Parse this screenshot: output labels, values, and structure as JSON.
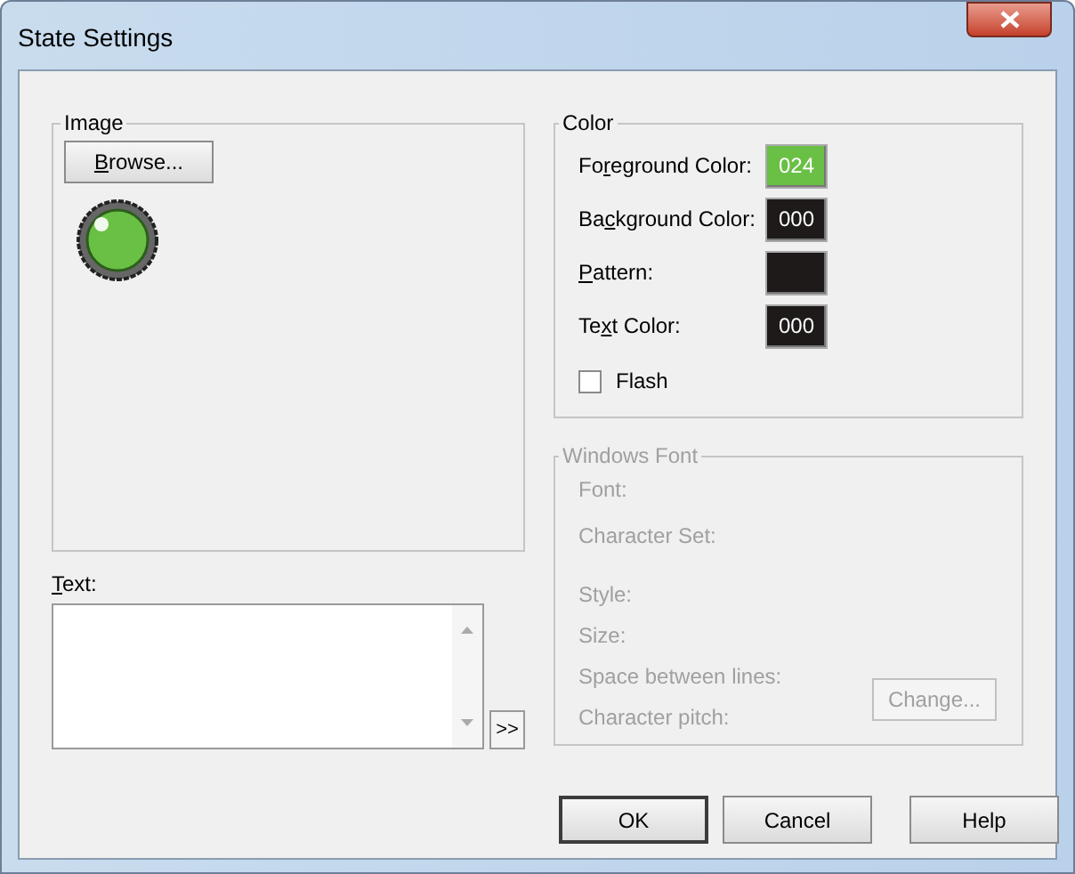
{
  "window": {
    "title": "State Settings"
  },
  "image_group": {
    "title": "Image",
    "browse_button": {
      "label": [
        {
          "text": "B",
          "underline": true
        },
        {
          "text": "rowse...",
          "underline": false
        }
      ]
    }
  },
  "text_group": {
    "label": [
      {
        "text": "T",
        "underline": true
      },
      {
        "text": "ext:",
        "underline": false
      }
    ],
    "value_button": ">>"
  },
  "color_group": {
    "title": "Color",
    "rows": [
      {
        "label": [
          {
            "text": "Fo",
            "underline": false
          },
          {
            "text": "r",
            "underline": true
          },
          {
            "text": "eground Color:",
            "underline": false
          }
        ],
        "swatch": "024",
        "color": "#6abf45"
      },
      {
        "label": [
          {
            "text": "Ba",
            "underline": false
          },
          {
            "text": "c",
            "underline": true
          },
          {
            "text": "kground Color:",
            "underline": false
          }
        ],
        "swatch": "000",
        "color": "#1e1a1a"
      },
      {
        "label": [
          {
            "text": "P",
            "underline": true
          },
          {
            "text": "attern:",
            "underline": false
          }
        ],
        "color": "#1e1a1a"
      },
      {
        "label": [
          {
            "text": "Te",
            "underline": false
          },
          {
            "text": "x",
            "underline": true
          },
          {
            "text": "t Color:",
            "underline": false
          }
        ],
        "swatch": "000",
        "color": "#1e1a1a"
      }
    ],
    "flash": {
      "label": "Flash",
      "checked": false
    }
  },
  "font_group": {
    "title": "Windows Font",
    "disabled": true,
    "rows": [
      "Font:",
      "Character Set:",
      "Style:",
      "Size:",
      "Space between lines:",
      "Character pitch:"
    ],
    "change_button": "Change..."
  },
  "buttons": [
    {
      "label": "OK",
      "default": true
    },
    {
      "label": "Cancel",
      "default": false
    },
    {
      "label": "Help",
      "default": false
    }
  ]
}
